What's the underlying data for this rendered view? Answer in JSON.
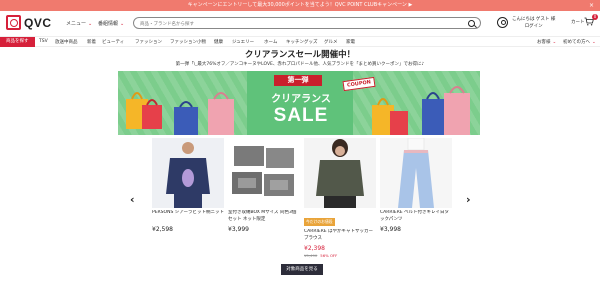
{
  "promo": {
    "text": "キャンペーンにエントリーして最大30,000ポイントを当てよう！QVC POINT CLUBキャンペーン ▶",
    "close": "×"
  },
  "header": {
    "logo_text": "QVC",
    "menu_label": "メニュー",
    "program_label": "番組情報",
    "search_placeholder": "商品・ブランド名から探す",
    "greeting_line1": "こんにちは ゲスト 様",
    "greeting_line2": "ログイン",
    "cart_label": "カート",
    "cart_count": "0"
  },
  "nav": {
    "items": [
      "商品を探す",
      "TSV",
      "放送中商品",
      "新着",
      "ビューティ",
      "ファッション",
      "ファッション小物",
      "健康",
      "ジュエリー",
      "ホーム",
      "キッチングッズ",
      "グルメ",
      "家電"
    ],
    "right_items": [
      "お客様",
      "初めての方へ"
    ]
  },
  "page": {
    "title": "クリアランスセール開催中！",
    "subtitle": "第一弾「\\_最大76%オフ／アンコキーヌやLOVE、赤れプロパドール他、人気ブランドを「まとめ買いクーポン」でお得に♪"
  },
  "banner": {
    "tag": "第一弾",
    "coupon": "COUPON",
    "line1": "クリアランス",
    "line2": "SALE"
  },
  "products": [
    {
      "badge": "",
      "name": "PERSONS シアーラビット柄ニット",
      "price": "¥2,598",
      "old_price": "",
      "discount": ""
    },
    {
      "badge": "",
      "name": "室付き収納BOX Mサイズ 同色3個セット ネット限定",
      "price": "¥3,999",
      "old_price": "",
      "discount": ""
    },
    {
      "badge": "今だけのお値段",
      "name": "CARRIERE ほやかギャトサッカーブラウス",
      "price": "¥2,398",
      "old_price": "¥5,490",
      "discount": "56% OFF"
    },
    {
      "badge": "",
      "name": "CARRIERE ベルト付きキレイ日タックパンツ",
      "price": "¥3,998",
      "old_price": "",
      "discount": ""
    }
  ],
  "carousel": {
    "prev": "‹",
    "next": "›"
  },
  "cta_label": "対象商品を見る",
  "colors": {
    "accent": "#d6203a",
    "promo": "#f07a6e",
    "banner_green": "#7ccd8c",
    "cta": "#2d2d3a"
  }
}
